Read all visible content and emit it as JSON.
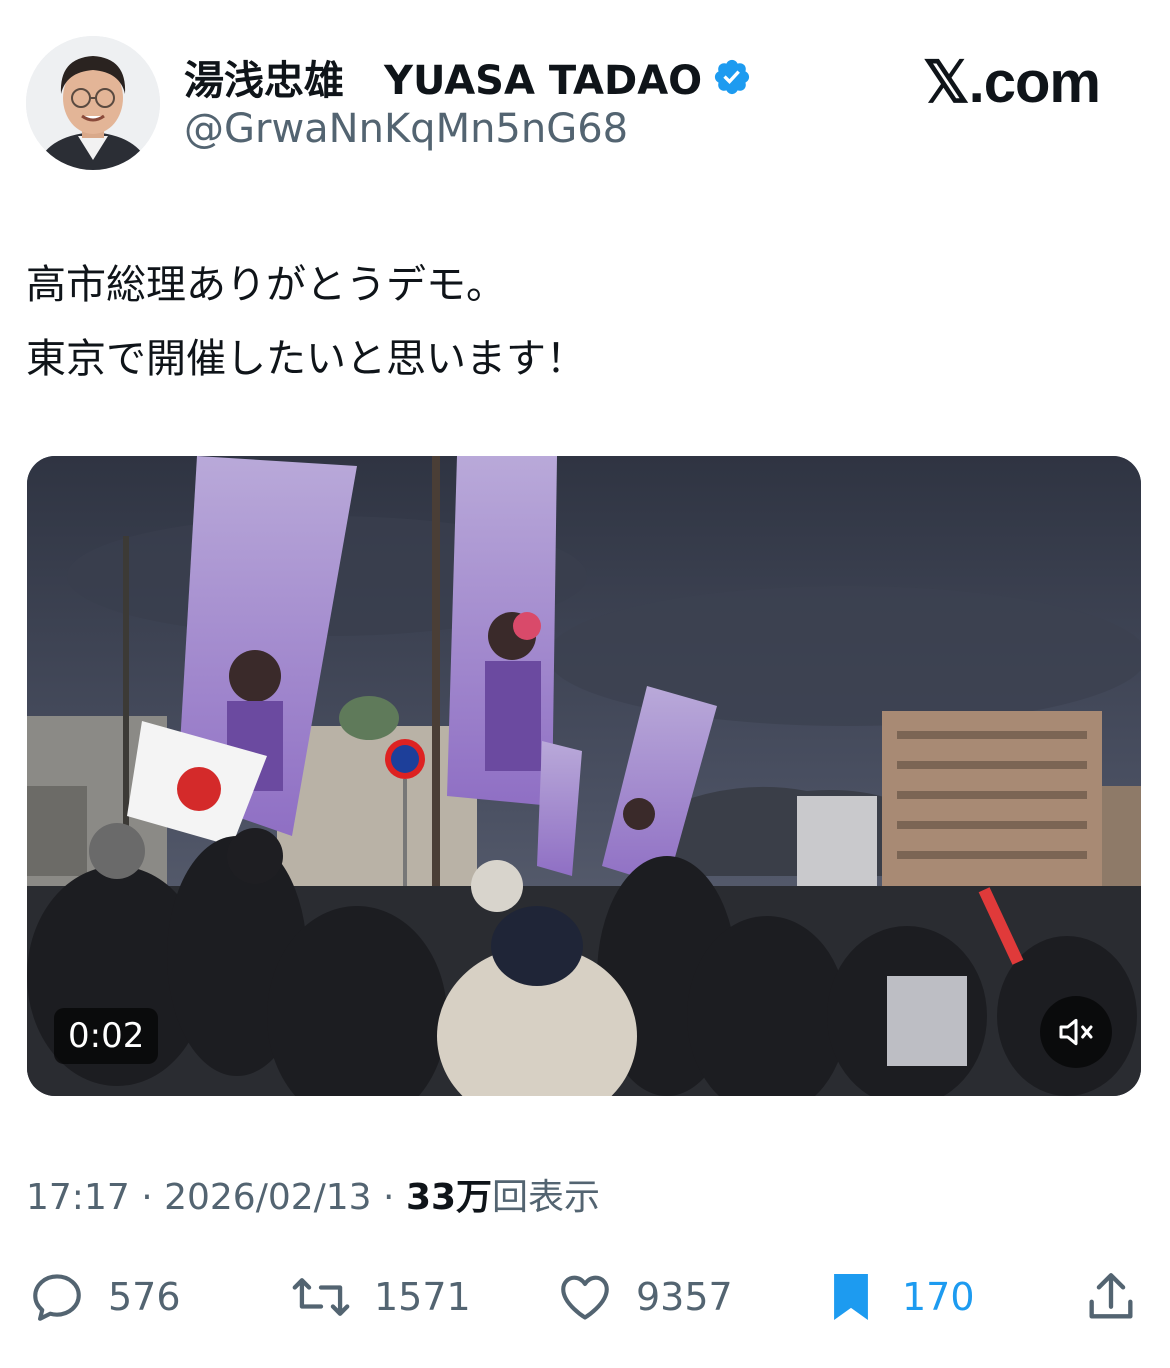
{
  "user": {
    "display_name": "湯浅忠雄　YUASA TADAO",
    "handle": "@GrwaNnKqMn5nG68",
    "verified_icon": "verified-badge-icon",
    "verified_color": "#1d9bf0"
  },
  "brand": {
    "label": "𝕏.com"
  },
  "tweet": {
    "lines": [
      "高市総理ありがとうデモ。",
      "東京で開催したいと思います！"
    ]
  },
  "media": {
    "timestamp": "0:02",
    "mute_icon": "speaker-muted-icon"
  },
  "meta": {
    "time": "17:17",
    "separator1": " · ",
    "date": "2026/02/13",
    "separator2": " · ",
    "views_count": "33万",
    "views_label": "回表示"
  },
  "actions": {
    "reply": {
      "icon": "reply-icon",
      "count": "576"
    },
    "retweet": {
      "icon": "retweet-icon",
      "count": "1571"
    },
    "like": {
      "icon": "heart-icon",
      "count": "9357"
    },
    "bookmark": {
      "icon": "bookmark-icon",
      "count": "170",
      "color": "#1d9bf0"
    },
    "share": {
      "icon": "share-icon"
    }
  },
  "colors": {
    "text_primary": "#0f1419",
    "text_secondary": "#536471",
    "accent": "#1d9bf0"
  }
}
